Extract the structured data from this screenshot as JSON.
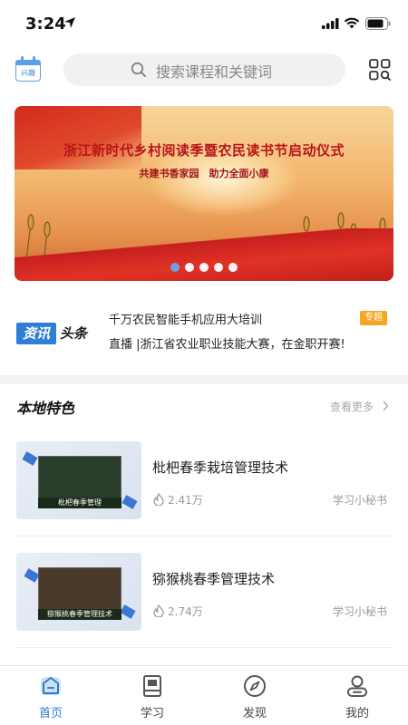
{
  "status": {
    "time": "3:24"
  },
  "header": {
    "calendar_label": "兴趣",
    "search_placeholder": "搜索课程和关键词"
  },
  "banner": {
    "title": "浙江新时代乡村阅读季暨农民读书节启动仪式",
    "subtitle": "共建书香家园　助力全面小康",
    "dots_count": 5,
    "active_dot": 0
  },
  "news": {
    "logo_left": "资讯",
    "logo_right": "头条",
    "headline1": "千万农民智能手机应用大培训",
    "headline2": "直播 |浙江省农业职业技能大赛，在金职开赛!",
    "tag": "专题"
  },
  "local_feature": {
    "title": "本地特色",
    "see_more": "查看更多",
    "courses": [
      {
        "name": "枇杷春季栽培管理技术",
        "views": "2.41万",
        "author": "学习小秘书",
        "thumb_caption": "枇杷春季管理"
      },
      {
        "name": "猕猴桃春季管理技术",
        "views": "2.74万",
        "author": "学习小秘书",
        "thumb_caption": "猕猴桃春季管理技术"
      }
    ]
  },
  "tabbar": {
    "items": [
      {
        "label": "首页",
        "icon": "home-icon",
        "active": true
      },
      {
        "label": "学习",
        "icon": "book-icon",
        "active": false
      },
      {
        "label": "发现",
        "icon": "compass-icon",
        "active": false
      },
      {
        "label": "我的",
        "icon": "profile-icon",
        "active": false
      }
    ]
  },
  "colors": {
    "accent": "#2d7ad8",
    "tag": "#f5a623",
    "banner_red": "#b8141a"
  }
}
